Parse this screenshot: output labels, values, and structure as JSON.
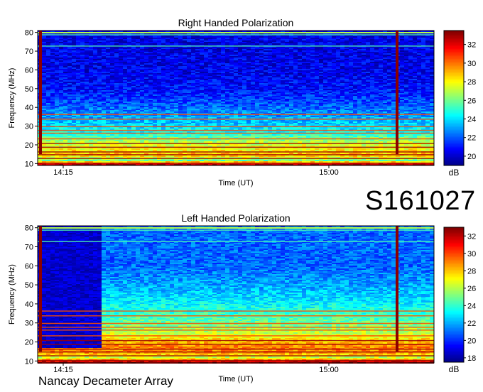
{
  "figure_id": "S161027",
  "footer_label": "Nancay Decameter Array",
  "chart_data": [
    {
      "type": "heatmap",
      "title": "Right Handed Polarization",
      "xlabel": "Time (UT)",
      "ylabel": "Frequency (MHz)",
      "x_ticks": [
        "14:15",
        "15:00"
      ],
      "y_ticks": [
        10,
        20,
        30,
        40,
        50,
        60,
        70,
        80
      ],
      "ylim": [
        9,
        81
      ],
      "colorbar": {
        "label": "dB",
        "ticks": [
          20,
          22,
          24,
          26,
          28,
          30,
          32
        ],
        "range": [
          19,
          33.5
        ]
      },
      "band_profile_db": [
        {
          "freq": 10,
          "db": 33
        },
        {
          "freq": 12,
          "db": 26
        },
        {
          "freq": 15,
          "db": 29
        },
        {
          "freq": 18,
          "db": 28
        },
        {
          "freq": 22,
          "db": 27
        },
        {
          "freq": 26,
          "db": 25
        },
        {
          "freq": 30,
          "db": 24
        },
        {
          "freq": 36,
          "db": 23
        },
        {
          "freq": 42,
          "db": 22
        },
        {
          "freq": 50,
          "db": 21
        },
        {
          "freq": 60,
          "db": 20.5
        },
        {
          "freq": 70,
          "db": 20.5
        },
        {
          "freq": 80,
          "db": 20.5
        }
      ]
    },
    {
      "type": "heatmap",
      "title": "Left Handed Polarization",
      "xlabel": "Time (UT)",
      "ylabel": "Frequency (MHz)",
      "x_ticks": [
        "14:15",
        "15:00"
      ],
      "y_ticks": [
        10,
        20,
        30,
        40,
        50,
        60,
        70,
        80
      ],
      "ylim": [
        9,
        81
      ],
      "colorbar": {
        "label": "dB",
        "ticks": [
          18,
          20,
          22,
          24,
          26,
          28,
          30,
          32
        ],
        "range": [
          17.5,
          33
        ]
      },
      "band_profile_db": [
        {
          "freq": 10,
          "db": 32
        },
        {
          "freq": 12,
          "db": 26
        },
        {
          "freq": 15,
          "db": 29
        },
        {
          "freq": 18,
          "db": 29
        },
        {
          "freq": 22,
          "db": 27.5
        },
        {
          "freq": 26,
          "db": 26
        },
        {
          "freq": 30,
          "db": 25
        },
        {
          "freq": 36,
          "db": 24
        },
        {
          "freq": 42,
          "db": 23
        },
        {
          "freq": 50,
          "db": 22
        },
        {
          "freq": 60,
          "db": 21
        },
        {
          "freq": 70,
          "db": 21
        },
        {
          "freq": 80,
          "db": 21
        }
      ]
    }
  ]
}
